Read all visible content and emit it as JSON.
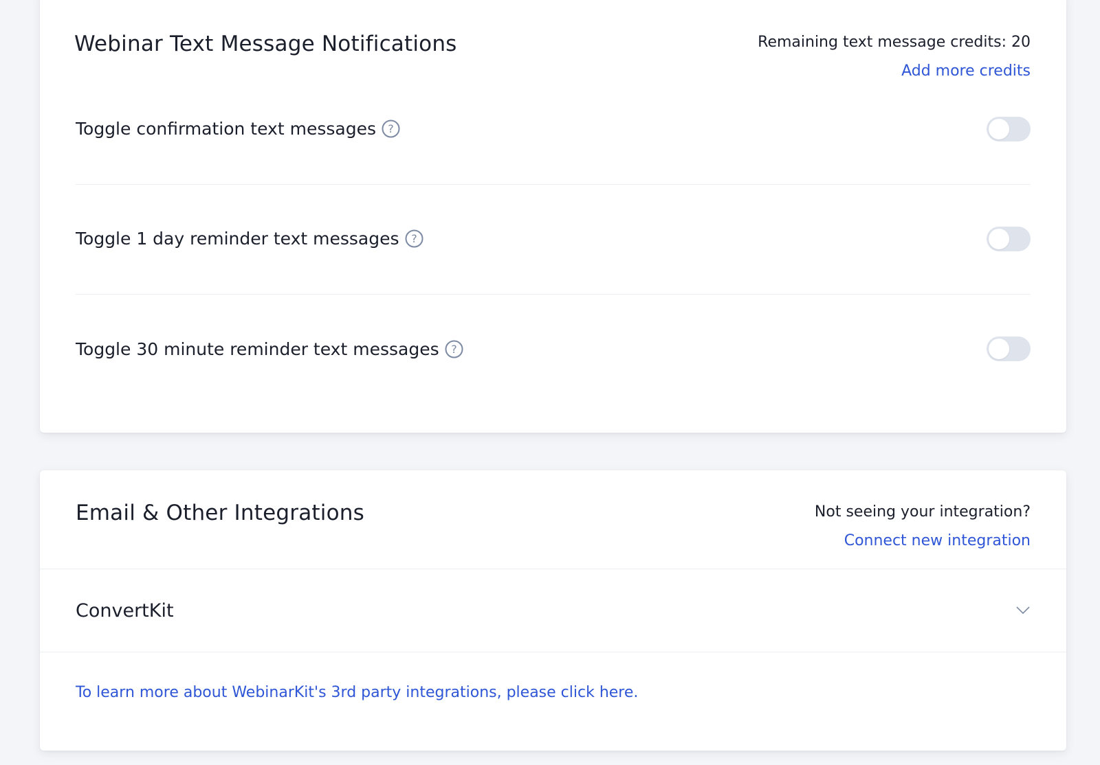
{
  "sms_section": {
    "title": "Webinar Text Message Notifications",
    "credits_text": "Remaining text message credits: 20",
    "add_credits_link": "Add more credits",
    "toggles": [
      {
        "label": "Toggle confirmation text messages",
        "enabled": false,
        "icon": "question-circle-icon"
      },
      {
        "label": "Toggle 1 day reminder text messages",
        "enabled": false,
        "icon": "question-circle-icon"
      },
      {
        "label": "Toggle 30 minute reminder text messages",
        "enabled": false,
        "icon": "question-circle-icon"
      }
    ]
  },
  "integrations_section": {
    "title": "Email & Other Integrations",
    "helper_text": "Not seeing your integration?",
    "connect_link": "Connect new integration",
    "items": [
      {
        "name": "ConvertKit",
        "icon": "chevron-down-icon"
      }
    ],
    "footer_link": "To learn more about WebinarKit's 3rd party integrations, please click here."
  },
  "colors": {
    "link": "#2f56d6",
    "toggle_off": "#dfe3ec",
    "help_icon": "#7d8aa3",
    "background": "#f4f5f8"
  }
}
